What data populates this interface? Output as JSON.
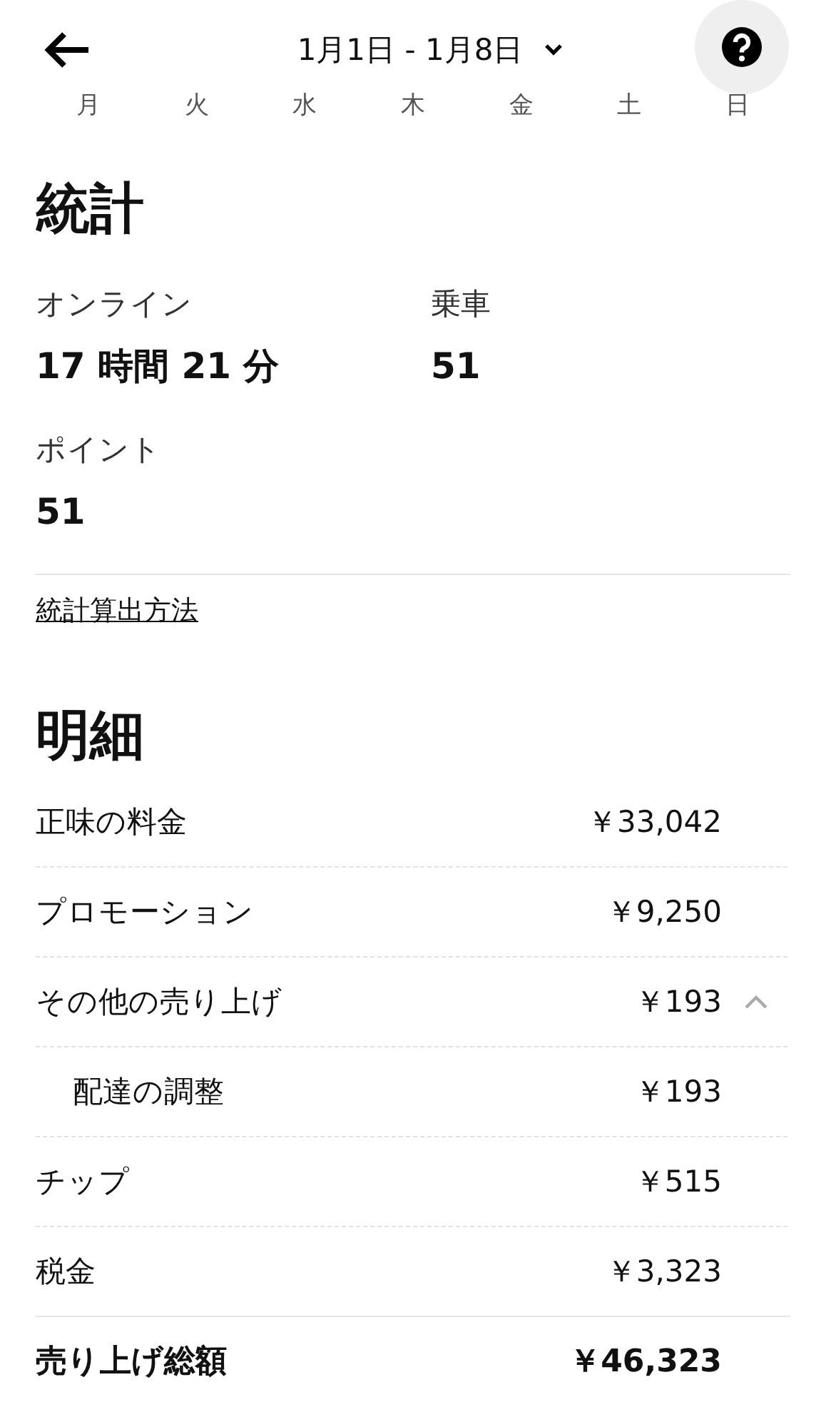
{
  "header": {
    "date_range": "1月1日 - 1月8日"
  },
  "weekdays": [
    "月",
    "火",
    "水",
    "木",
    "金",
    "土",
    "日"
  ],
  "stats": {
    "title": "統計",
    "items": [
      {
        "label": "オンライン",
        "value": "17 時間 21 分"
      },
      {
        "label": "乗車",
        "value": "51"
      },
      {
        "label": "ポイント",
        "value": "51"
      }
    ],
    "link": "統計算出方法"
  },
  "breakdown": {
    "title": "明細",
    "rows": [
      {
        "kind": "item",
        "label": "正味の料金",
        "amount": "￥33,042"
      },
      {
        "kind": "item",
        "label": "プロモーション",
        "amount": "￥9,250"
      },
      {
        "kind": "item",
        "label": "その他の売り上げ",
        "amount": "￥193",
        "expanded": true,
        "children": [
          {
            "kind": "item",
            "label": "配達の調整",
            "amount": "￥193"
          }
        ]
      },
      {
        "kind": "item",
        "label": "チップ",
        "amount": "￥515"
      },
      {
        "kind": "item",
        "label": "税金",
        "amount": "￥3,323"
      },
      {
        "kind": "total",
        "label": "売り上げ総額",
        "amount": "￥46,323"
      }
    ]
  }
}
